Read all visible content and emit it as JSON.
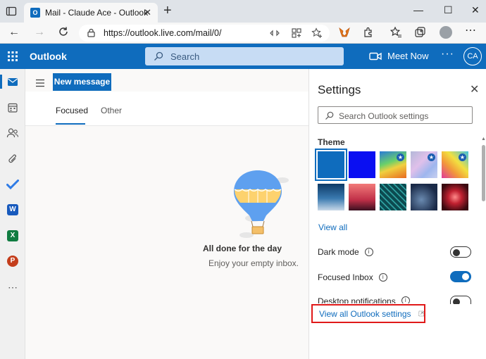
{
  "browser": {
    "tab_title": "Mail - Claude Ace - Outlook",
    "favicon_letter": "O",
    "url": "https://outlook.live.com/mail/0/"
  },
  "header": {
    "brand": "Outlook",
    "search_placeholder": "Search",
    "meet_now": "Meet Now",
    "more": "···",
    "avatar_initials": "CA",
    "accent_color": "#0f6cbd"
  },
  "rail": {
    "items": [
      "mail-icon",
      "calendar-icon",
      "people-icon",
      "attach-icon",
      "todo-icon",
      "word-icon",
      "excel-icon",
      "powerpoint-icon",
      "more-apps-icon"
    ],
    "word_letter": "W",
    "excel_letter": "X",
    "powerpoint_letter": "P"
  },
  "mail": {
    "new_message": "New message",
    "tabs": [
      "Focused",
      "Other"
    ],
    "active_tab": "Focused",
    "empty_title": "All done for the day",
    "empty_subtitle": "Enjoy your empty inbox."
  },
  "settings": {
    "title": "Settings",
    "search_placeholder": "Search Outlook settings",
    "theme_label": "Theme",
    "view_all": "View all",
    "dark_mode": "Dark mode",
    "dark_mode_on": false,
    "focused_inbox": "Focused Inbox",
    "focused_inbox_on": true,
    "desktop_notifications": "Desktop notifications",
    "view_all_outlook_settings": "View all Outlook settings",
    "highlight_color": "#e01919"
  }
}
